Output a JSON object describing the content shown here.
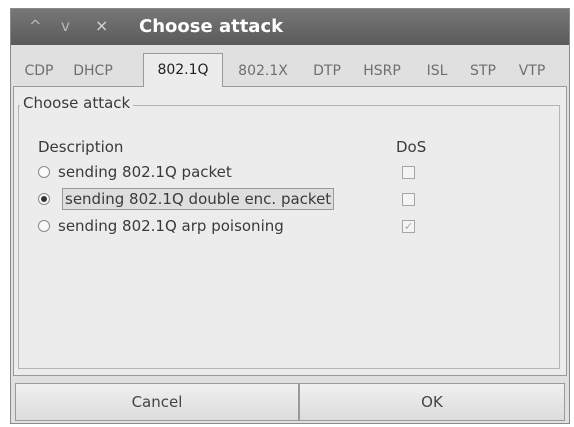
{
  "window": {
    "title": "Choose attack",
    "controls": {
      "minimize": "^",
      "maximize": "v",
      "close": "×"
    }
  },
  "tabs": [
    {
      "label": "CDP",
      "active": false
    },
    {
      "label": "DHCP",
      "active": false
    },
    {
      "label": "802.1Q",
      "active": true
    },
    {
      "label": "802.1X",
      "active": false
    },
    {
      "label": "DTP",
      "active": false
    },
    {
      "label": "HSRP",
      "active": false
    },
    {
      "label": "ISL",
      "active": false
    },
    {
      "label": "STP",
      "active": false
    },
    {
      "label": "VTP",
      "active": false
    }
  ],
  "group": {
    "title": "Choose attack",
    "columns": {
      "description": "Description",
      "dos": "DoS"
    },
    "attacks": [
      {
        "label": "sending 802.1Q packet",
        "selected": false,
        "dos": false
      },
      {
        "label": "sending 802.1Q double enc. packet",
        "selected": true,
        "dos": false
      },
      {
        "label": "sending 802.1Q arp poisoning",
        "selected": false,
        "dos": true
      }
    ]
  },
  "buttons": {
    "cancel": "Cancel",
    "ok": "OK"
  },
  "colors": {
    "titlebar": "#5a5a5a",
    "window_bg": "#e0e0e0",
    "panel_bg": "#ececec"
  }
}
